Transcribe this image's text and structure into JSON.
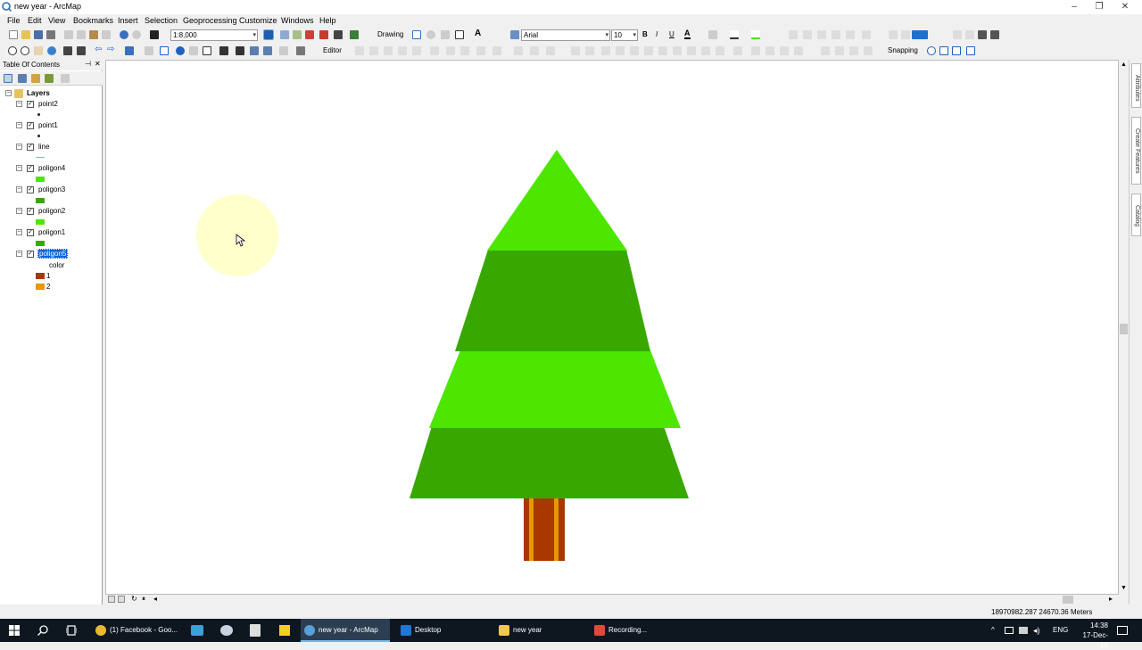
{
  "window": {
    "title": "new year - ArcMap",
    "controls": [
      "–",
      "❐",
      "✕"
    ]
  },
  "menu": [
    "File",
    "Edit",
    "View",
    "Bookmarks",
    "Insert",
    "Selection",
    "Geoprocessing",
    "Customize",
    "Windows",
    "Help"
  ],
  "toolbar": {
    "scale": "1:8,000",
    "drawing_label": "Drawing",
    "font_name": "Arial",
    "font_size": "10",
    "bold": "B",
    "italic": "I",
    "underline": "U",
    "font_color_glyph": "A",
    "editor_label": "Editor",
    "snapping_label": "Snapping"
  },
  "toc": {
    "title": "Table Of Contents",
    "pin": "⊣",
    "close": "✕",
    "root": "Layers",
    "layers": [
      {
        "name": "point2",
        "symbol": "dot",
        "color": "#222222"
      },
      {
        "name": "point1",
        "symbol": "dot",
        "color": "#222222"
      },
      {
        "name": "line",
        "symbol": "line",
        "color": "#7fbf9f"
      },
      {
        "name": "poligon4",
        "symbol": "fill",
        "color": "#4ce600"
      },
      {
        "name": "poligon3",
        "symbol": "fill",
        "color": "#38a800"
      },
      {
        "name": "poligon2",
        "symbol": "fill",
        "color": "#4ce600"
      },
      {
        "name": "poligon1",
        "symbol": "fill",
        "color": "#38a800"
      },
      {
        "name": "poligon5",
        "symbol": "unique",
        "selected": true,
        "field": "color",
        "classes": [
          {
            "label": "1",
            "color": "#a83800"
          },
          {
            "label": "2",
            "color": "#e69800"
          }
        ]
      }
    ]
  },
  "map": {
    "tree_colors": {
      "light": "#4ce600",
      "dark": "#38a800",
      "trunk": "#a83800",
      "trunk_stripe": "#e69800"
    },
    "highlight_color": "#ffffcc"
  },
  "dock_tabs": [
    "Attributes",
    "Create Features",
    "Catalog"
  ],
  "status": {
    "coordinates": "18970982.287  24670.36 Meters"
  },
  "taskbar": {
    "items": [
      {
        "label": "(1) Facebook - Goo...",
        "color": "#e8b830"
      },
      {
        "label": "new year - ArcMap",
        "color": "#5aa0d8",
        "active": true
      },
      {
        "label": "Desktop",
        "color": "#1e78d7"
      },
      {
        "label": "new year",
        "color": "#f2c84b"
      },
      {
        "label": "Recording...",
        "color": "#e04a3a"
      }
    ],
    "language": "ENG",
    "time": "14:38",
    "date": "17-Dec-19"
  }
}
